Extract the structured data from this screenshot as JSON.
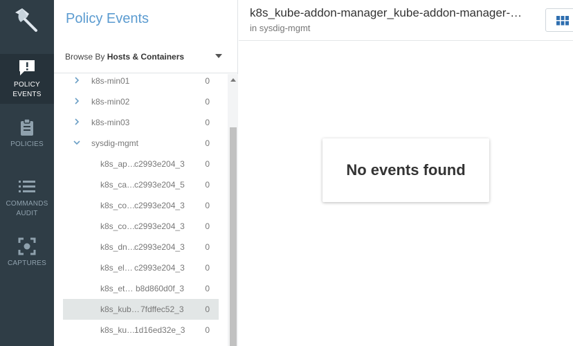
{
  "nav": {
    "items": [
      {
        "label_line1": "POLICY",
        "label_line2": "EVENTS",
        "icon": "alert-message-icon",
        "active": true
      },
      {
        "label_line1": "POLICIES",
        "label_line2": "",
        "icon": "clipboard-icon",
        "active": false
      },
      {
        "label_line1": "COMMANDS",
        "label_line2": "AUDIT",
        "icon": "list-icon",
        "active": false
      },
      {
        "label_line1": "CAPTURES",
        "label_line2": "",
        "icon": "capture-target-icon",
        "active": false
      }
    ]
  },
  "panel": {
    "title": "Policy Events",
    "browse_prefix": "Browse By",
    "browse_value": "Hosts & Containers"
  },
  "tree": {
    "rows": [
      {
        "name": "k8s-min01",
        "suffix": "",
        "count": "0",
        "level": 1,
        "chevron": "right",
        "selected": false
      },
      {
        "name": "k8s-min02",
        "suffix": "",
        "count": "0",
        "level": 1,
        "chevron": "right",
        "selected": false
      },
      {
        "name": "k8s-min03",
        "suffix": "",
        "count": "0",
        "level": 1,
        "chevron": "right",
        "selected": false
      },
      {
        "name": "sysdig-mgmt",
        "suffix": "",
        "count": "0",
        "level": 1,
        "chevron": "down",
        "selected": false
      },
      {
        "name": "k8s_ap…",
        "suffix": "c2993e204_3",
        "count": "0",
        "level": 2,
        "chevron": "",
        "selected": false
      },
      {
        "name": "k8s_ca…",
        "suffix": "c2993e204_5",
        "count": "0",
        "level": 2,
        "chevron": "",
        "selected": false
      },
      {
        "name": "k8s_co…",
        "suffix": "c2993e204_3",
        "count": "0",
        "level": 2,
        "chevron": "",
        "selected": false
      },
      {
        "name": "k8s_co…",
        "suffix": "c2993e204_3",
        "count": "0",
        "level": 2,
        "chevron": "",
        "selected": false
      },
      {
        "name": "k8s_dn…",
        "suffix": "c2993e204_3",
        "count": "0",
        "level": 2,
        "chevron": "",
        "selected": false
      },
      {
        "name": "k8s_el…",
        "suffix": "c2993e204_3",
        "count": "0",
        "level": 2,
        "chevron": "",
        "selected": false
      },
      {
        "name": "k8s_et…",
        "suffix": "b8d860d0f_3",
        "count": "0",
        "level": 2,
        "chevron": "",
        "selected": false
      },
      {
        "name": "k8s_kub…",
        "suffix": "7fdffec52_3",
        "count": "0",
        "level": 2,
        "chevron": "",
        "selected": true
      },
      {
        "name": "k8s_ku…",
        "suffix": "1d16ed32e_3",
        "count": "0",
        "level": 2,
        "chevron": "",
        "selected": false
      }
    ]
  },
  "main": {
    "title": "k8s_kube-addon-manager_kube-addon-manager-…",
    "subtitle": "in sysdig-mgmt",
    "empty_message": "No events found",
    "view_toggle_icon": "grid-view-icon"
  },
  "colors": {
    "nav_bg": "#2f3d46",
    "accent": "#5b9bd0",
    "selected_row": "#e2e6e6"
  }
}
